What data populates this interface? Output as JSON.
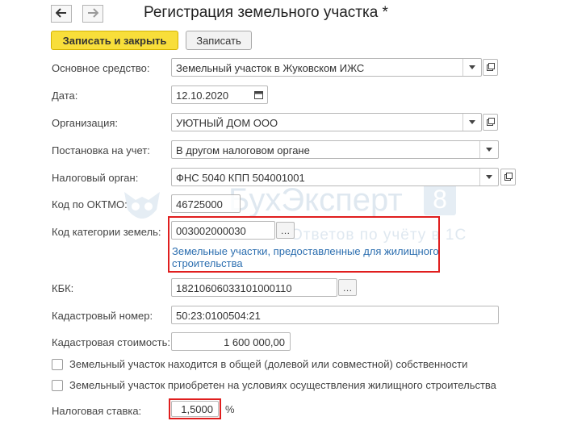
{
  "window": {
    "title": "Регистрация земельного участка *"
  },
  "toolbar": {
    "back_icon": "arrow-left-icon",
    "forward_icon": "arrow-right-icon",
    "save_close_label": "Записать и закрыть",
    "save_label": "Записать"
  },
  "fields": {
    "asset": {
      "label": "Основное средство:",
      "value": "Земельный участок в Жуковском ИЖС"
    },
    "date": {
      "label": "Дата:",
      "value": "12.10.2020"
    },
    "organization": {
      "label": "Организация:",
      "value": "УЮТНЫЙ ДОМ ООО"
    },
    "registration": {
      "label": "Постановка на учет:",
      "value": "В другом налоговом органе"
    },
    "tax_authority": {
      "label": "Налоговый орган:",
      "value": "ФНС 5040 КПП 504001001"
    },
    "oktmo": {
      "label": "Код по ОКТМО:",
      "value": "46725000"
    },
    "land_category": {
      "label": "Код категории земель:",
      "value": "003002000030",
      "description_line1": "Земельные участки, предоставленные для жилищного",
      "description_line2": "строительства"
    },
    "kbk": {
      "label": "КБК:",
      "value": "18210606033101000110"
    },
    "cadastral_number": {
      "label": "Кадастровый номер:",
      "value": "50:23:0100504:21"
    },
    "cadastral_value": {
      "label": "Кадастровая стоимость:",
      "value": "1 600 000,00"
    },
    "tax_rate": {
      "label": "Налоговая ставка:",
      "value": "1,5000",
      "unit": "%"
    }
  },
  "checkboxes": {
    "shared_ownership": {
      "label": "Земельный участок находится в общей (долевой или совместной) собственности",
      "checked": false
    },
    "housing_construction": {
      "label": "Земельный участок приобретен на условиях осуществления жилищного строительства",
      "checked": false
    }
  },
  "watermark": {
    "brand": "БухЭксперт",
    "number": "8",
    "tagline": "Ответов по учёту в 1С"
  },
  "colors": {
    "primary_button": "#f8de3a",
    "highlight": "#e01e1e",
    "link": "#2d6fb0"
  }
}
